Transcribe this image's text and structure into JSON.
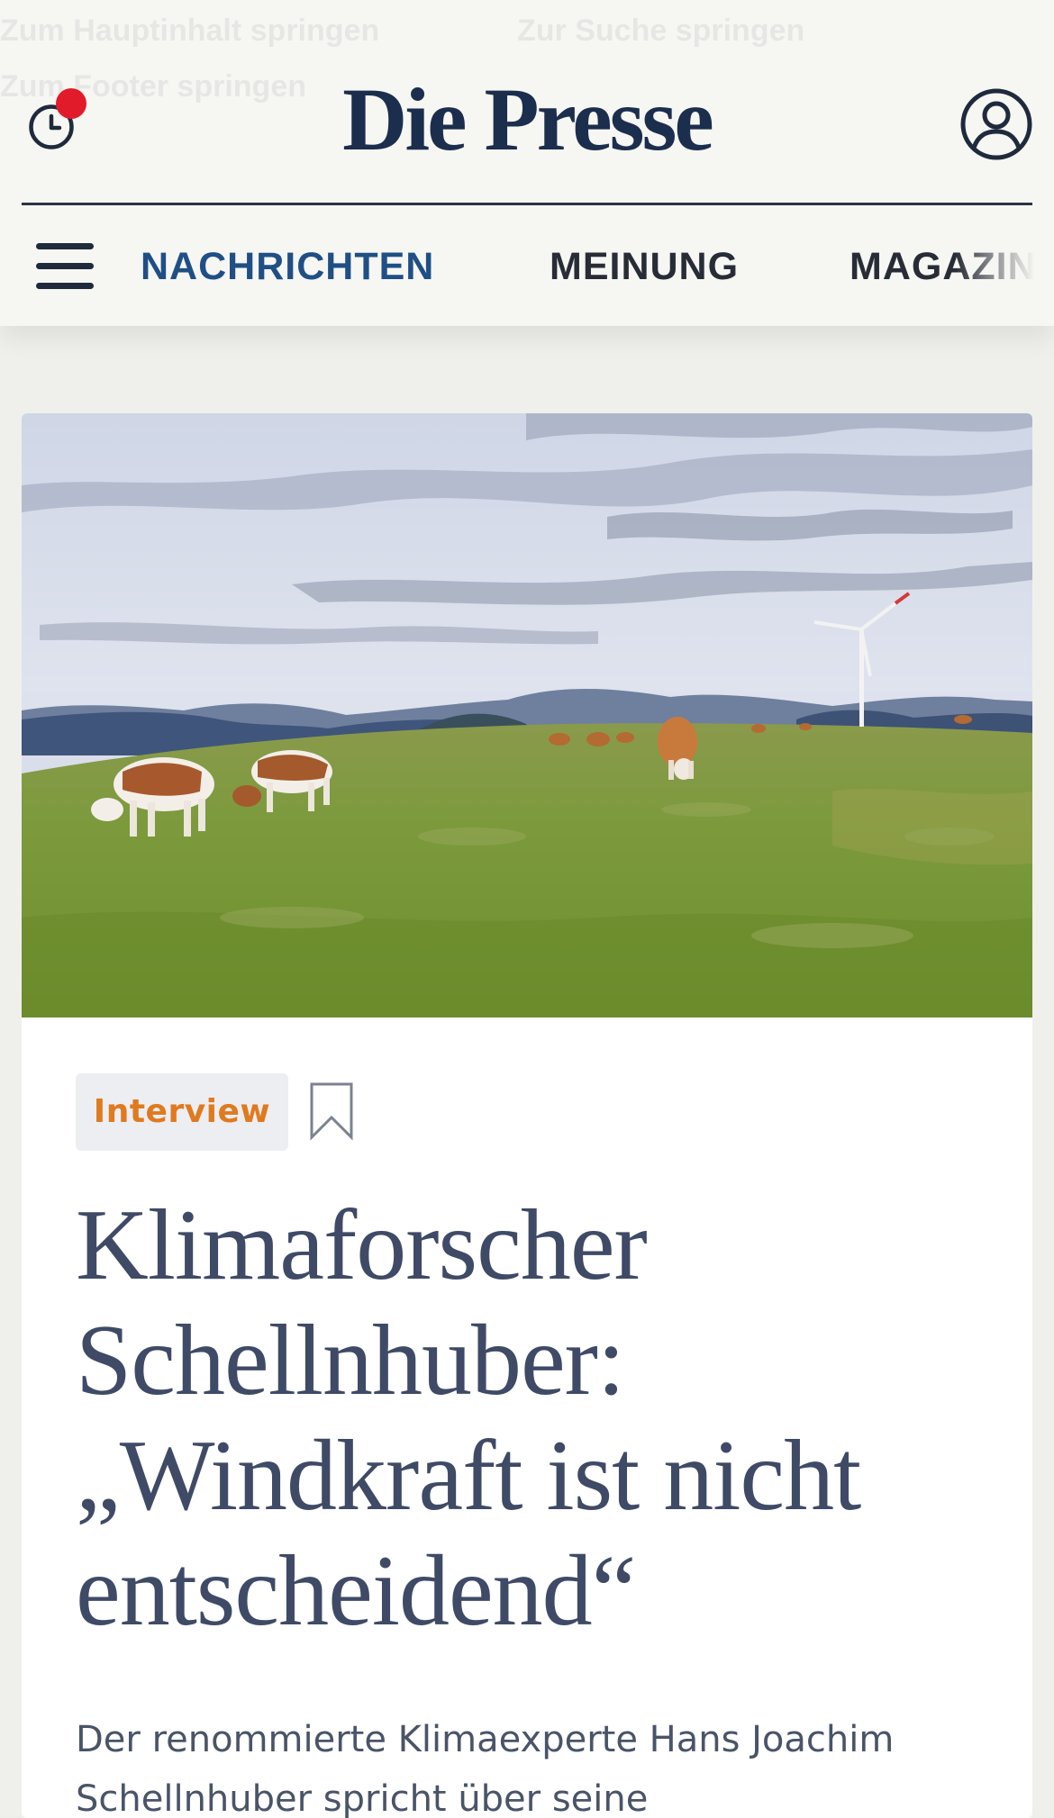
{
  "skip_links": {
    "main_content": "Zum Hauptinhalt springen",
    "search": "Zur Suche springen",
    "footer": "Zum Footer springen"
  },
  "header": {
    "logo": "Die Presse",
    "history_icon": "history-clock-icon",
    "account_icon": "user-account-icon",
    "notification_color": "#e11b2a"
  },
  "nav": {
    "menu_icon": "hamburger-menu-icon",
    "items": [
      {
        "label": "NACHRICHTEN",
        "active": true
      },
      {
        "label": "MEINUNG",
        "active": false
      },
      {
        "label": "MAGAZIN",
        "active": false
      }
    ]
  },
  "article": {
    "image_alt": "Kühe auf einer Alm mit Windrad",
    "tag": "Interview",
    "bookmark_icon": "bookmark-icon",
    "headline": "Klimaforscher Schellnhuber: „Windkraft ist nicht entscheidend“",
    "teaser": "Der renommierte Klimaexperte Hans Joachim Schellnhuber spricht über seine"
  },
  "colors": {
    "brand_navy": "#1c2e4d",
    "nav_active": "#1f4f85",
    "tag_orange": "#e07a1f",
    "headline": "#3f4a66"
  }
}
